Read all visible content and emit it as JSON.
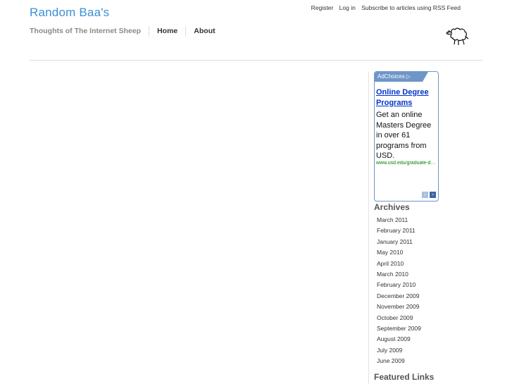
{
  "site": {
    "title": "Random Baa's",
    "tagline": "Thoughts of The Internet Sheep"
  },
  "topnav": {
    "register": "Register",
    "login": "Log in",
    "rss": "Subscribe to articles using RSS Feed"
  },
  "mainnav": [
    {
      "label": "Home"
    },
    {
      "label": "About"
    }
  ],
  "ad": {
    "choices_label": "AdChoices ▷",
    "headline": "Online Degree Programs",
    "body": "Get an online Masters Degree in over 61 programs from USD.",
    "url": "www.usd.edu/graduate-degrees",
    "prev": "‹",
    "next": "›",
    "border_color": "#6e96c8"
  },
  "archives": {
    "title": "Archives",
    "items": [
      "March 2011",
      "February 2011",
      "January 2011",
      "May 2010",
      "April 2010",
      "March 2010",
      "February 2010",
      "December 2009",
      "November 2009",
      "October 2009",
      "September 2009",
      "August 2009",
      "July 2009",
      "June 2009"
    ]
  },
  "featured": {
    "title": "Featured Links"
  },
  "colors": {
    "title_blue": "#3b8fd6",
    "ad_link": "#0033cc",
    "ad_url": "#008000"
  }
}
